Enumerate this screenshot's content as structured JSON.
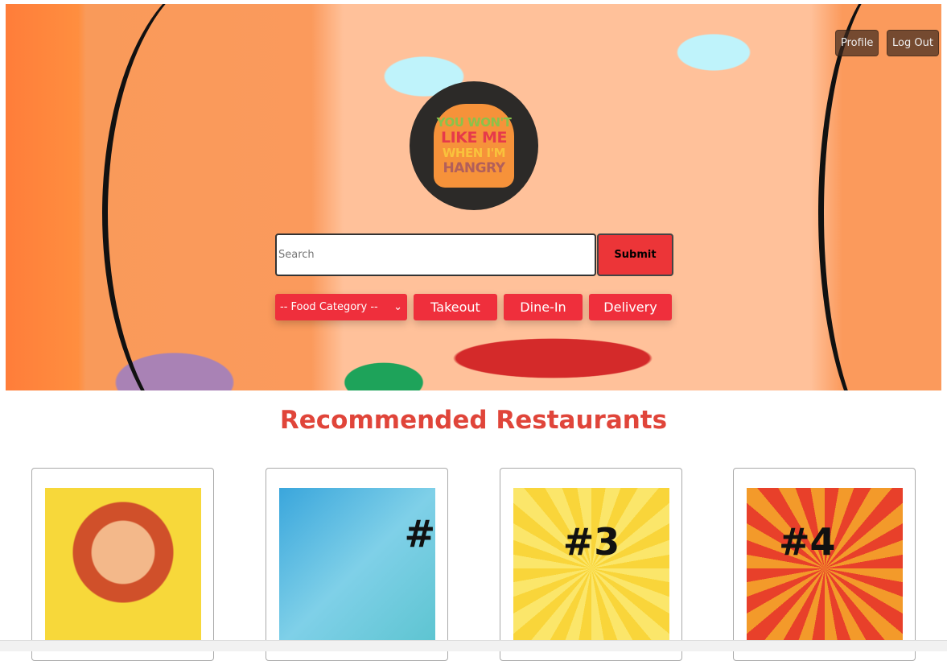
{
  "header": {
    "profile": "Profile",
    "logout": "Log Out"
  },
  "logo": {
    "lines": [
      "YOU WON'T",
      "LIKE ME",
      "WHEN I'M",
      "HANGRY"
    ]
  },
  "search": {
    "placeholder": "Search",
    "submit": "Submit"
  },
  "filters": {
    "category": "-- Food Category --",
    "takeout": "Takeout",
    "dinein": "Dine-In",
    "delivery": "Delivery"
  },
  "section_title": "Recommended Restaurants",
  "cards": [
    {
      "label": ""
    },
    {
      "label": "#"
    },
    {
      "label": "#3"
    },
    {
      "label": "#4"
    }
  ],
  "colors": {
    "accent": "#ef2f3c",
    "title": "#e0453a"
  }
}
